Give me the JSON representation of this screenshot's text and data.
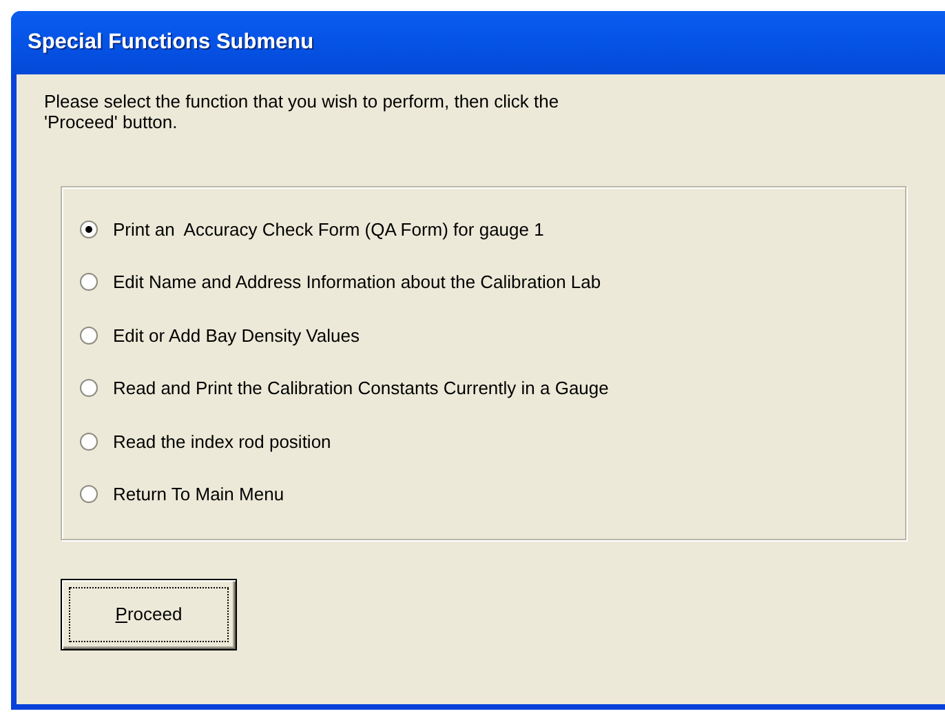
{
  "window": {
    "title": "Special Functions Submenu"
  },
  "instructions": "Please select the function that you wish to perform, then click the\n'Proceed' button.",
  "options": [
    {
      "label": "Print an  Accuracy Check Form (QA Form) for gauge 1",
      "selected": true
    },
    {
      "label": "Edit Name and Address Information about the Calibration Lab",
      "selected": false
    },
    {
      "label": "Edit or Add Bay Density Values",
      "selected": false
    },
    {
      "label": "Read and Print the Calibration Constants Currently in a Gauge",
      "selected": false
    },
    {
      "label": "Read the index rod position",
      "selected": false
    },
    {
      "label": "Return To Main Menu",
      "selected": false
    }
  ],
  "buttons": [
    {
      "label": "Proceed",
      "focused": true
    }
  ]
}
